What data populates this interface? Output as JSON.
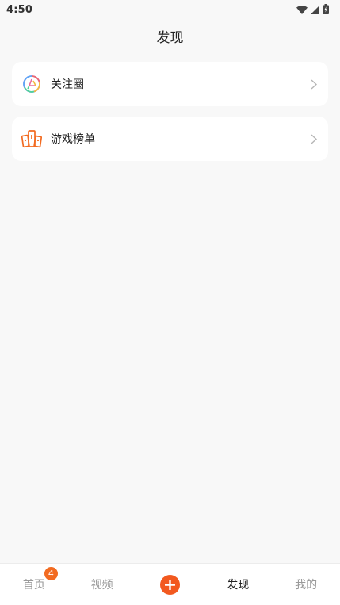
{
  "status_bar": {
    "time": "4:50"
  },
  "header": {
    "title": "发现"
  },
  "menu": {
    "items": [
      {
        "label": "关注圈",
        "icon": "circle-aperture-icon"
      },
      {
        "label": "游戏榜单",
        "icon": "podium-ranking-icon"
      }
    ]
  },
  "bottom_nav": {
    "items": [
      {
        "label": "首页",
        "badge": "4",
        "active": false
      },
      {
        "label": "视频",
        "active": false
      },
      {
        "label": "",
        "icon": "plus-icon"
      },
      {
        "label": "发现",
        "active": true
      },
      {
        "label": "我的",
        "active": false
      }
    ]
  },
  "colors": {
    "accent": "#f2591f",
    "badge": "#f26b21",
    "background": "#f8f8f8",
    "inactive_text": "#9a9a9a"
  }
}
